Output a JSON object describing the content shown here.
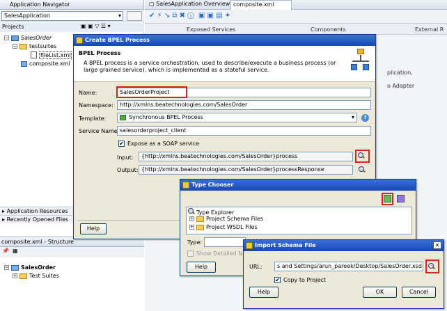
{
  "app_navigator": {
    "title": "Application Navigator",
    "app_name": "SalesApplication",
    "projects_label": "Projects",
    "tree": [
      "SalesOrder",
      "testsuites",
      "fileList.xml",
      "composite.xml"
    ],
    "bottom_sections": [
      "Application Resources",
      "Recently Opened Files"
    ]
  },
  "structure": {
    "title": "composite.xml - Structure",
    "tree": [
      "SalesOrder",
      "Test Suites"
    ]
  },
  "editor": {
    "tabs": [
      "SalesApplication Overview",
      "composite.xml"
    ],
    "columns": [
      "Exposed Services",
      "Components",
      "External R"
    ],
    "bg_texts": [
      "plication,",
      "o Adapter"
    ]
  },
  "create_bpel": {
    "title": "Create BPEL Process",
    "heading": "BPEL Process",
    "description": "A BPEL process is a service orchestration, used to describe/execute a business process (or large grained service), which is implemented as a stateful service.",
    "labels": {
      "name": "Name:",
      "namespace": "Namespace:",
      "template": "Template:",
      "service_name": "Service Name:",
      "expose": "Expose as a SOAP service",
      "input": "Input:",
      "output": "Output:"
    },
    "values": {
      "name": "SalesOrderProject",
      "namespace": "http://xmlns.beatechnologies.com/SalesOrder",
      "template": "Synchronous BPEL Process",
      "service_name": "salesorderproject_client",
      "input": "{http://xmlns.beatechnologies.com/SalesOrder}process",
      "output": "{http://xmlns.beatechnologies.com/SalesOrder}processResponse"
    },
    "help_label": "Help"
  },
  "type_chooser": {
    "title": "Type Chooser",
    "tree": [
      "Type Explorer",
      "Project Schema Files",
      "Project WSDL Files"
    ],
    "type_label": "Type:",
    "show_label": "Show Detailed Node",
    "help_label": "Help"
  },
  "import_schema": {
    "title": "Import Schema File",
    "url_label": "URL:",
    "url_value": "s and Settings/arun_pareek/Desktop/SalesOrder.xsd",
    "copy_label": "Copy to Project",
    "help_label": "Help",
    "ok_label": "OK",
    "cancel_label": "Cancel"
  },
  "colors": {
    "titlebar": "#1548b5",
    "highlight": "#e0201c",
    "dialog_bg": "#ece9d8"
  }
}
